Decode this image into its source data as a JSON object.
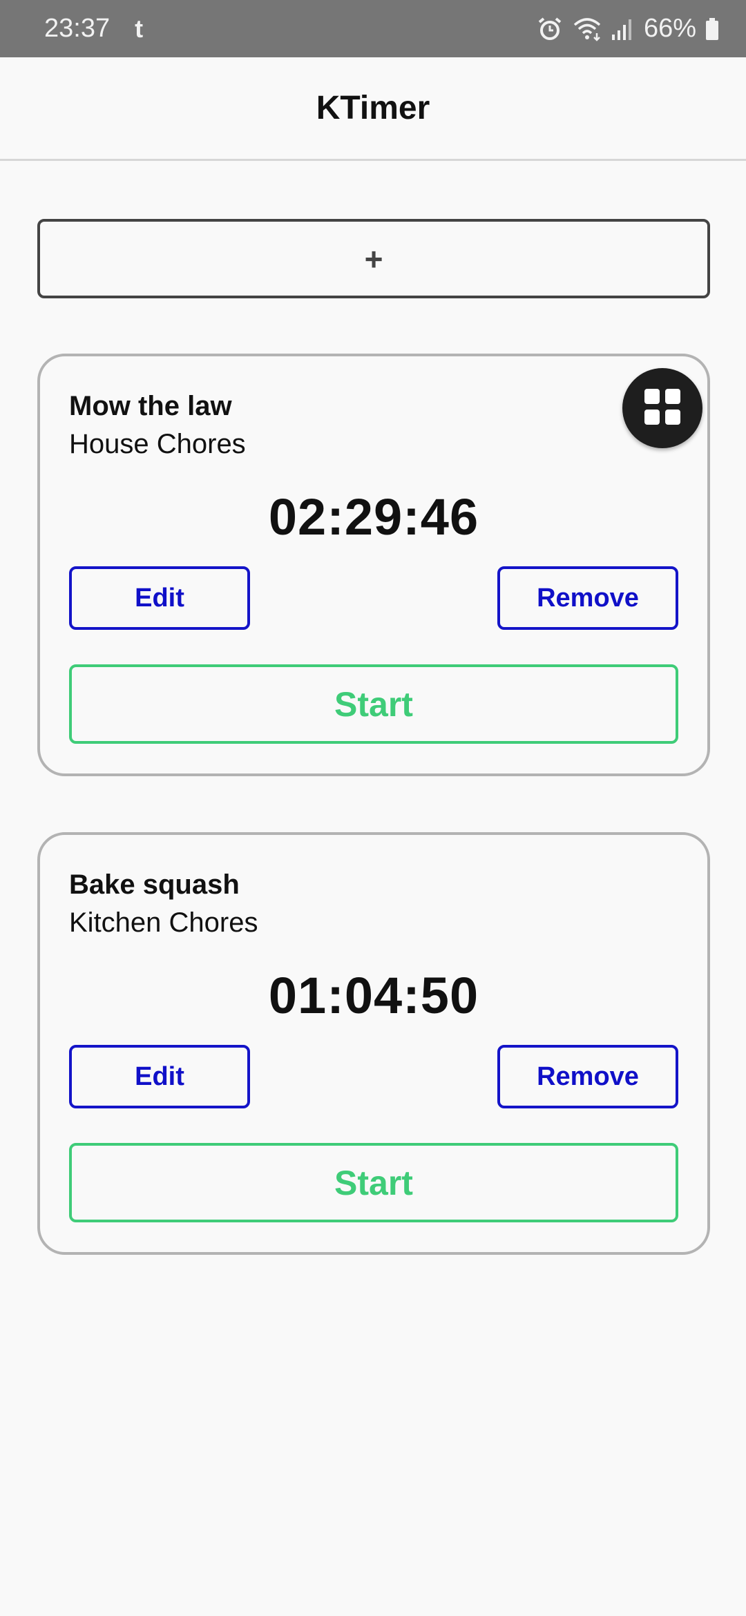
{
  "status_bar": {
    "time": "23:37",
    "notification_icon": "t",
    "battery": "66%",
    "icons": [
      "alarm-icon",
      "wifi-icon",
      "signal-icon",
      "battery-icon"
    ]
  },
  "header": {
    "title": "KTimer"
  },
  "add_button": {
    "label": "+"
  },
  "timers": [
    {
      "name": "Mow the law",
      "category": "House Chores",
      "time": "02:29:46",
      "edit_label": "Edit",
      "remove_label": "Remove",
      "start_label": "Start"
    },
    {
      "name": "Bake squash",
      "category": "Kitchen Chores",
      "time": "01:04:50",
      "edit_label": "Edit",
      "remove_label": "Remove",
      "start_label": "Start"
    }
  ],
  "fab": {
    "icon": "grid-icon"
  },
  "colors": {
    "accent_blue": "#1010c8",
    "start_green": "#3fcc78",
    "status_bar": "#767676"
  }
}
